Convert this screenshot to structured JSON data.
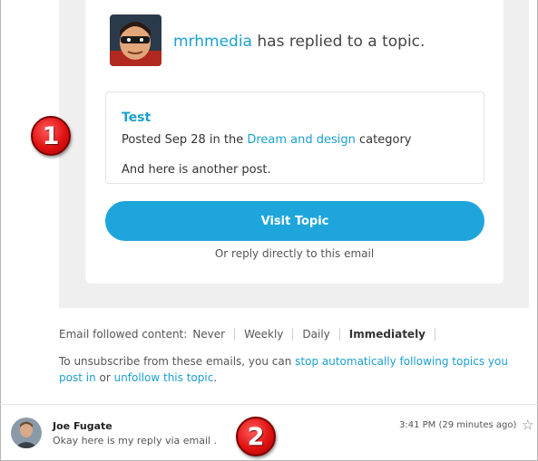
{
  "notification": {
    "username": "mrhmedia",
    "headline_rest": " has replied to a topic.",
    "post": {
      "title": "Test",
      "meta_prefix": "Posted Sep 28 in the ",
      "category": "Dream and design",
      "meta_suffix": " category",
      "body": "And here is another post."
    },
    "visit_button": "Visit Topic",
    "reply_note": "Or reply directly to this email"
  },
  "footer": {
    "followed_label": "Email followed content:",
    "options": [
      "Never",
      "Weekly",
      "Daily",
      "Immediately"
    ],
    "selected_option": "Immediately",
    "unsub_prefix": "To unsubscribe from these emails, you can ",
    "unsub_link": "stop automatically following topics you post in",
    "unsub_middle": " or ",
    "unfollow_link": "unfollow this topic",
    "unsub_suffix": "."
  },
  "reply": {
    "sender": "Joe Fugate",
    "snippet": "Okay here is my reply via email .",
    "time": "3:41 PM (29 minutes ago)"
  },
  "annotations": {
    "badge_1": "1",
    "badge_2": "2"
  },
  "icons": {
    "star": "star-outline-icon"
  },
  "colors": {
    "link": "#1ca0d0",
    "button": "#1ea6dc",
    "badge": "#e01212"
  }
}
